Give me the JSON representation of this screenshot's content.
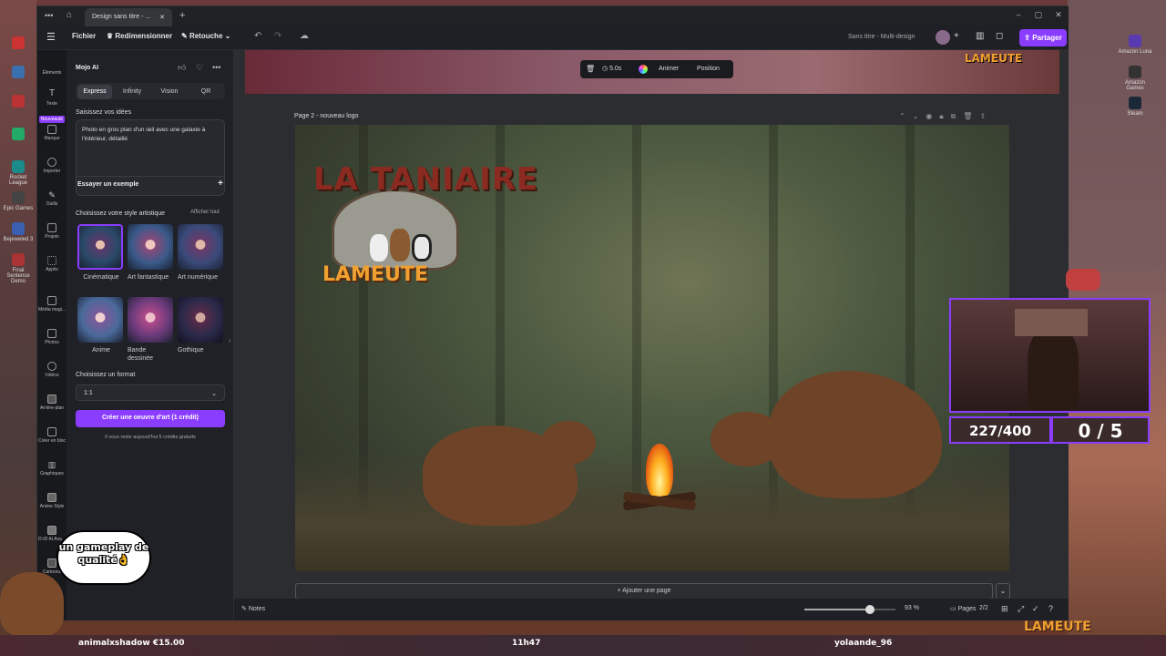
{
  "browser": {
    "tab_title": "Design sans titre - ...",
    "new_tab": "+"
  },
  "app_header": {
    "menu": "Fichier",
    "resize": "Redimensionner",
    "retouch": "Retouche",
    "doc_title": "Sans titre - Multi-design",
    "share": "Partager"
  },
  "rail": [
    {
      "label": "Éléments",
      "icon": "elements-icon"
    },
    {
      "label": "Texte",
      "icon": "text-icon"
    },
    {
      "label": "Nouveauté",
      "icon": "badge"
    },
    {
      "label": "Marque",
      "icon": "brand-icon"
    },
    {
      "label": "Importer",
      "icon": "upload-icon"
    },
    {
      "label": "Outils",
      "icon": "pencil-icon"
    },
    {
      "label": "Projets",
      "icon": "folder-icon"
    },
    {
      "label": "Applis",
      "icon": "apps-icon"
    },
    {
      "label": "Média magi...",
      "icon": "magic-media-icon"
    },
    {
      "label": "Photos",
      "icon": "photo-icon"
    },
    {
      "label": "Vidéos",
      "icon": "video-icon"
    },
    {
      "label": "Arrière-plan",
      "icon": "background-icon"
    },
    {
      "label": "Créer en bloc",
      "icon": "bulk-icon"
    },
    {
      "label": "Graphiques",
      "icon": "chart-icon"
    },
    {
      "label": "Anime Style",
      "icon": "anime-icon"
    },
    {
      "label": "D-ID AI Ava...",
      "icon": "avatar-icon"
    },
    {
      "label": "Cartoons",
      "icon": "cartoon-icon"
    }
  ],
  "panel": {
    "title": "Mojo AI",
    "tabs": [
      "Express",
      "Infinity",
      "Vision",
      "QR"
    ],
    "prompt_label": "Saisissez vos idées",
    "prompt_value": "Photo en gros plan d'un œil avec une galaxie à l'intérieur, détaillé",
    "example_btn": "Essayer un exemple",
    "style_label": "Choisissez votre style artistique",
    "show_all": "Afficher tout",
    "styles": [
      "Cinématique",
      "Art fantastique",
      "Art numérique",
      "Anime",
      "Bande dessinée",
      "Gothique"
    ],
    "format_label": "Choisissez un format",
    "format_value": "1:1",
    "create_btn": "Créer une oeuvre d'art (1 crédit)",
    "credits_note": "Il vous reste aujourd'hui 5 crédits gratuits"
  },
  "floating_toolbar": {
    "duration": "5.0s",
    "animate": "Animer",
    "position": "Position"
  },
  "page": {
    "label": "Page 2 - nouveau logo",
    "add_page": "+ Ajouter une page",
    "logo_top": "LA TANIAIRE",
    "logo_bottom": "LAMEUTE"
  },
  "status": {
    "notes": "Notes",
    "zoom": "93 %",
    "pages": "Pages",
    "page_count": "2/2",
    "zoom_fraction": 0.72
  },
  "desktop_right": [
    "Amazon Luna",
    "Amazon Games",
    "Steam"
  ],
  "desktop_left": [
    "Rocket League",
    "Epic Games",
    "Bejeweled 3",
    "Final Sentence Demo"
  ],
  "overlay": {
    "counter1": "227/400",
    "counter2": "0 / 5",
    "bubble": "un gameplay de qualité👌",
    "ticker_left": "animalxshadow €15.00",
    "clock": "11h47",
    "ticker_right": "yolaande_96"
  },
  "colors": {
    "accent": "#8b3dff"
  }
}
